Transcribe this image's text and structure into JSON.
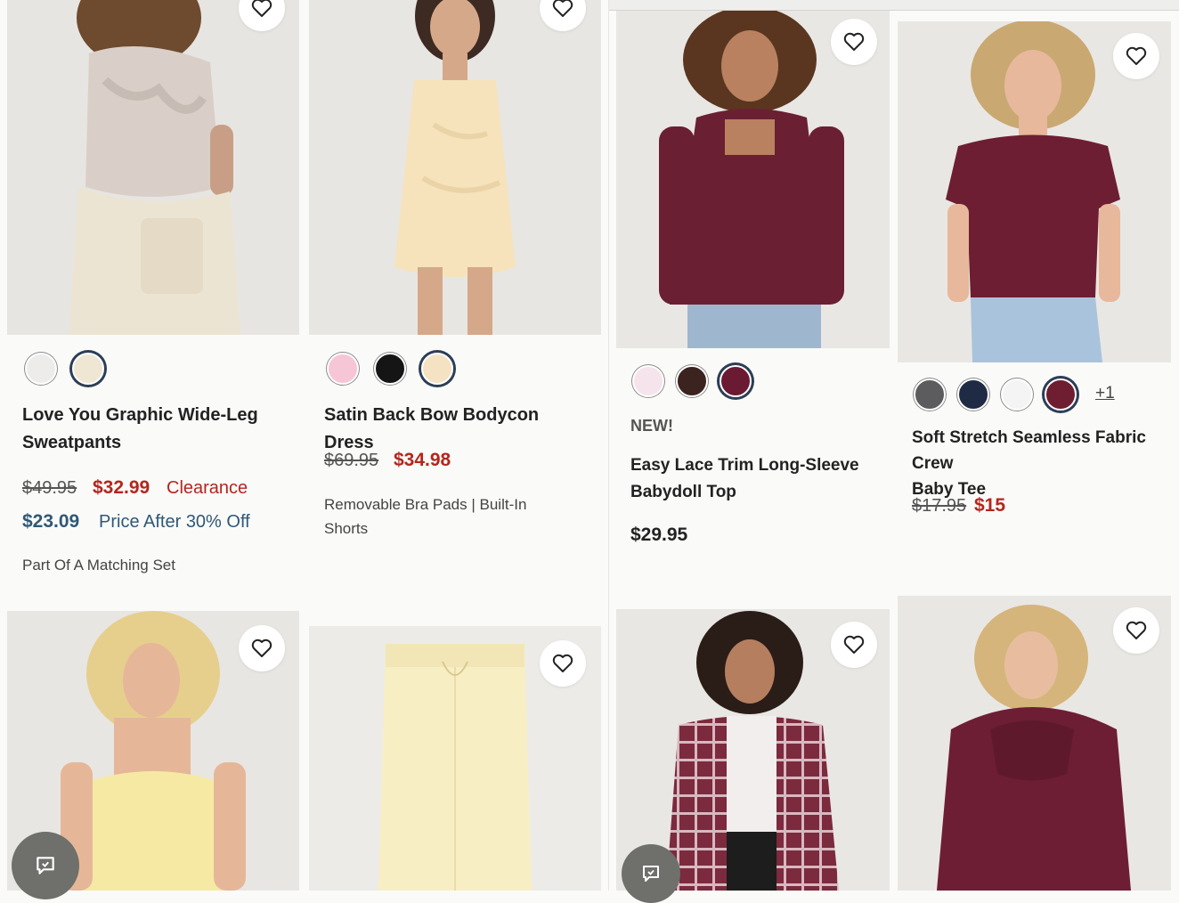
{
  "products": [
    {
      "title": "Love You Graphic Wide-Leg Sweatpants",
      "title_line1": "Love You Graphic Wide-Leg",
      "title_line2": "Sweatpants",
      "original_price": "$49.95",
      "sale_price": "$32.99",
      "sale_label": "Clearance",
      "promo_price": "$23.09",
      "promo_label": "Price After 30% Off",
      "note": "Part Of A Matching Set",
      "swatches": [
        "#eeeceb",
        "#efe6d4"
      ],
      "selected_swatch": 1
    },
    {
      "title": "Satin Back Bow Bodycon Dress",
      "original_price": "$69.95",
      "sale_price": "$34.98",
      "note_line1": "Removable Bra Pads | Built-In",
      "note_line2": "Shorts",
      "swatches": [
        "#f6c6d6",
        "#151515",
        "#f4e2c2"
      ],
      "selected_swatch": 2
    },
    {
      "badge": "NEW!",
      "title_line1": "Easy Lace Trim Long-Sleeve",
      "title_line2": "Babydoll Top",
      "price": "$29.95",
      "swatches": [
        "#f6e4ec",
        "#3b2320",
        "#6b1a33"
      ],
      "selected_swatch": 2
    },
    {
      "title_line1": "Soft Stretch Seamless Fabric Crew",
      "title_line2": "Baby Tee",
      "original_price": "$17.95",
      "sale_price": "$15",
      "swatches": [
        "#5c5c5e",
        "#1f2b45",
        "#f4f4f4",
        "#6e1e30"
      ],
      "selected_swatch": 3,
      "more_colors": "+1"
    }
  ],
  "icons": {
    "favorite": "heart-outline-icon",
    "chat": "chat-bubble-icon"
  },
  "colors": {
    "sale_red": "#b3261e",
    "promo_blue": "#2f5877",
    "selected_ring": "#2c3e57"
  }
}
